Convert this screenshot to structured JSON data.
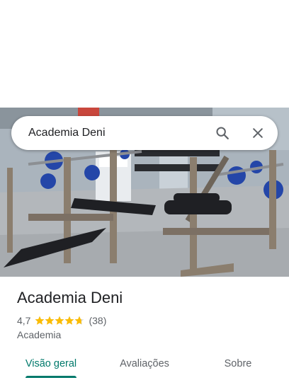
{
  "search": {
    "query": "Academia Deni"
  },
  "place": {
    "name": "Academia Deni",
    "rating": "4,7",
    "rating_fraction": 0.94,
    "review_count": "(38)",
    "category": "Academia"
  },
  "tabs": [
    {
      "label": "Visão geral",
      "active": true
    },
    {
      "label": "Avaliações",
      "active": false
    },
    {
      "label": "Sobre",
      "active": false
    }
  ],
  "colors": {
    "accent": "#00796b",
    "star": "#fbbc04",
    "star_empty": "#dadce0",
    "text_primary": "#202124",
    "text_secondary": "#5f6368"
  },
  "icons": {
    "search": "search-icon",
    "close": "close-icon",
    "star": "star-icon"
  }
}
